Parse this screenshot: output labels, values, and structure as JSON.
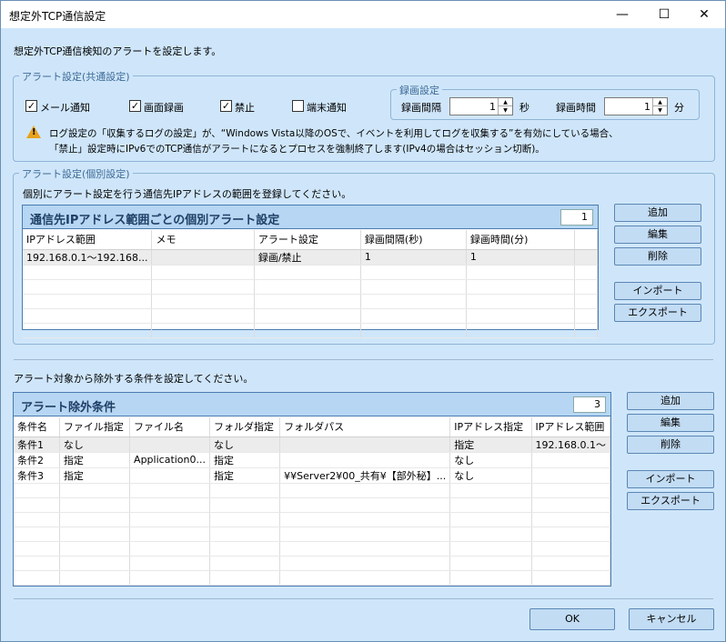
{
  "window": {
    "title": "想定外TCP通信設定"
  },
  "intro": "想定外TCP通信検知のアラートを設定します。",
  "common": {
    "legend": "アラート設定(共通設定)",
    "checks": [
      {
        "label": "メール通知",
        "checked": true
      },
      {
        "label": "画面録画",
        "checked": true
      },
      {
        "label": "禁止",
        "checked": true
      },
      {
        "label": "端末通知",
        "checked": false
      }
    ],
    "record": {
      "legend": "録画設定",
      "interval_label": "録画間隔",
      "interval_value": "1",
      "interval_unit": "秒",
      "duration_label": "録画時間",
      "duration_value": "1",
      "duration_unit": "分"
    },
    "warning_line1": "ログ設定の「収集するログの設定」が、“Windows Vista以降のOSで、イベントを利用してログを収集する”を有効にしている場合、",
    "warning_line2": "「禁止」設定時にIPv6でのTCP通信がアラートになるとプロセスを強制終了します(IPv4の場合はセッション切断)。"
  },
  "individual": {
    "legend": "アラート設定(個別設定)",
    "desc": "個別にアラート設定を行う通信先IPアドレスの範囲を登録してください。",
    "panel_title": "通信先IPアドレス範囲ごとの個別アラート設定",
    "count": "1",
    "columns": [
      "IPアドレス範囲",
      "メモ",
      "アラート設定",
      "録画間隔(秒)",
      "録画時間(分)"
    ],
    "rows": [
      [
        "192.168.0.1～192.168...",
        "",
        "録画/禁止",
        "1",
        "1"
      ]
    ],
    "buttons": {
      "add": "追加",
      "edit": "編集",
      "delete": "削除",
      "import": "インポート",
      "export": "エクスポート"
    }
  },
  "exclude": {
    "desc": "アラート対象から除外する条件を設定してください。",
    "panel_title": "アラート除外条件",
    "count": "3",
    "columns": [
      "条件名",
      "ファイル指定",
      "ファイル名",
      "フォルダ指定",
      "フォルダパス",
      "IPアドレス指定",
      "IPアドレス範囲"
    ],
    "rows": [
      [
        "条件1",
        "なし",
        "",
        "なし",
        "",
        "指定",
        "192.168.0.1～"
      ],
      [
        "条件2",
        "指定",
        "Application0...",
        "指定",
        "",
        "なし",
        ""
      ],
      [
        "条件3",
        "指定",
        "",
        "指定",
        "¥¥Server2¥00_共有¥【部外秘】...",
        "なし",
        ""
      ]
    ],
    "buttons": {
      "add": "追加",
      "edit": "編集",
      "delete": "削除",
      "import": "インポート",
      "export": "エクスポート"
    }
  },
  "footer": {
    "ok": "OK",
    "cancel": "キャンセル"
  }
}
